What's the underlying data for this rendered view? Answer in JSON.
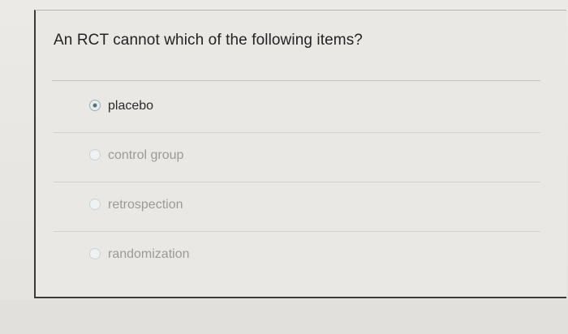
{
  "question": {
    "text": "An RCT cannot which of the following items?"
  },
  "options": [
    {
      "label": "placebo",
      "selected": true
    },
    {
      "label": "control group",
      "selected": false
    },
    {
      "label": "retrospection",
      "selected": false
    },
    {
      "label": "randomization",
      "selected": false
    }
  ],
  "colors": {
    "background": "#e7e6e2",
    "text": "#232323",
    "dim_text": "#9b9a96",
    "radio_selected": "#5d6f74"
  }
}
